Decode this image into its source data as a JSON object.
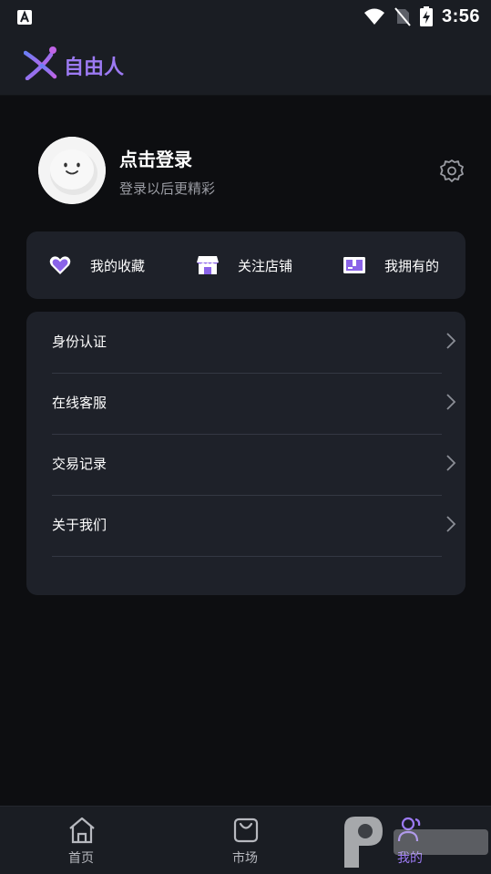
{
  "status_bar": {
    "time": "3:56"
  },
  "app": {
    "title": "自由人"
  },
  "profile": {
    "name": "点击登录",
    "subtitle": "登录以后更精彩"
  },
  "quick_actions": [
    {
      "label": "我的收藏",
      "icon": "heart-icon"
    },
    {
      "label": "关注店铺",
      "icon": "store-icon"
    },
    {
      "label": "我拥有的",
      "icon": "box-icon"
    }
  ],
  "menu": [
    {
      "label": "身份认证"
    },
    {
      "label": "在线客服"
    },
    {
      "label": "交易记录"
    },
    {
      "label": "关于我们"
    }
  ],
  "tabs": [
    {
      "label": "首页",
      "icon": "home-icon"
    },
    {
      "label": "市场",
      "icon": "bag-icon"
    },
    {
      "label": "我的",
      "icon": "user-icon"
    }
  ],
  "colors": {
    "accent": "#9c7af3",
    "card": "#1e2129",
    "background": "#0d0e11"
  }
}
